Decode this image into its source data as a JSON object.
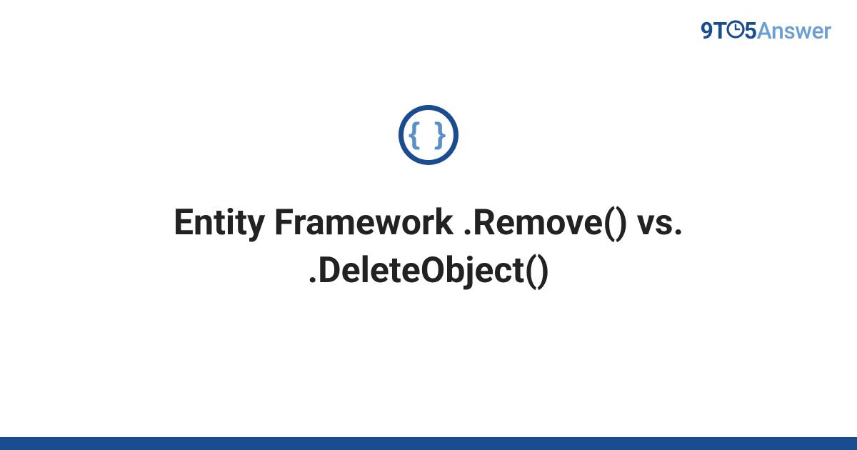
{
  "brand": {
    "part1": "9T",
    "clock_o": "O",
    "part2": "5",
    "part3": "Answer"
  },
  "icon": {
    "braces": "{ }"
  },
  "title": "Entity Framework .Remove() vs. .DeleteObject()",
  "colors": {
    "primary": "#1a4d8f",
    "accent": "#6a9ed4",
    "icon_braces": "#5a8fc7",
    "text": "#222222",
    "background": "#ffffff"
  }
}
